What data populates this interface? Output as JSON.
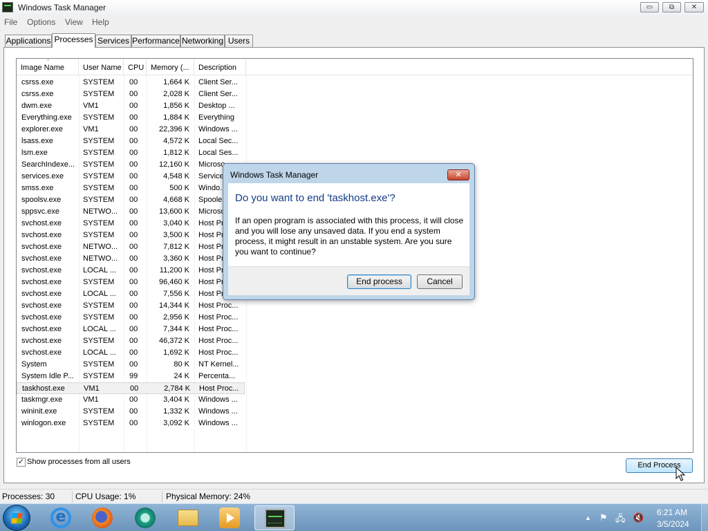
{
  "window": {
    "title": "Windows Task Manager",
    "controls": {
      "minimize": "▭",
      "maximize": "⧉",
      "close": "✕"
    }
  },
  "menu": [
    "File",
    "Options",
    "View",
    "Help"
  ],
  "tabs": [
    "Applications",
    "Processes",
    "Services",
    "Performance",
    "Networking",
    "Users"
  ],
  "active_tab": "Processes",
  "columns": [
    "Image Name",
    "User Name",
    "CPU",
    "Memory (...",
    "Description"
  ],
  "sort_indicator": "^",
  "processes": [
    {
      "name": "csrss.exe",
      "user": "SYSTEM",
      "cpu": "00",
      "memory": "1,664 K",
      "description": "Client Ser..."
    },
    {
      "name": "csrss.exe",
      "user": "SYSTEM",
      "cpu": "00",
      "memory": "2,028 K",
      "description": "Client Ser..."
    },
    {
      "name": "dwm.exe",
      "user": "VM1",
      "cpu": "00",
      "memory": "1,856 K",
      "description": "Desktop ..."
    },
    {
      "name": "Everything.exe",
      "user": "SYSTEM",
      "cpu": "00",
      "memory": "1,884 K",
      "description": "Everything"
    },
    {
      "name": "explorer.exe",
      "user": "VM1",
      "cpu": "00",
      "memory": "22,396 K",
      "description": "Windows ..."
    },
    {
      "name": "lsass.exe",
      "user": "SYSTEM",
      "cpu": "00",
      "memory": "4,572 K",
      "description": "Local Sec..."
    },
    {
      "name": "lsm.exe",
      "user": "SYSTEM",
      "cpu": "00",
      "memory": "1,812 K",
      "description": "Local Ses..."
    },
    {
      "name": "SearchIndexe...",
      "user": "SYSTEM",
      "cpu": "00",
      "memory": "12,160 K",
      "description": "Microso..."
    },
    {
      "name": "services.exe",
      "user": "SYSTEM",
      "cpu": "00",
      "memory": "4,548 K",
      "description": "Service..."
    },
    {
      "name": "smss.exe",
      "user": "SYSTEM",
      "cpu": "00",
      "memory": "500 K",
      "description": "Windo..."
    },
    {
      "name": "spoolsv.exe",
      "user": "SYSTEM",
      "cpu": "00",
      "memory": "4,668 K",
      "description": "Spoole..."
    },
    {
      "name": "sppsvc.exe",
      "user": "NETWO...",
      "cpu": "00",
      "memory": "13,600 K",
      "description": "Microso..."
    },
    {
      "name": "svchost.exe",
      "user": "SYSTEM",
      "cpu": "00",
      "memory": "3,040 K",
      "description": "Host Pr..."
    },
    {
      "name": "svchost.exe",
      "user": "SYSTEM",
      "cpu": "00",
      "memory": "3,500 K",
      "description": "Host Pr..."
    },
    {
      "name": "svchost.exe",
      "user": "NETWO...",
      "cpu": "00",
      "memory": "7,812 K",
      "description": "Host Pr..."
    },
    {
      "name": "svchost.exe",
      "user": "NETWO...",
      "cpu": "00",
      "memory": "3,360 K",
      "description": "Host Pr..."
    },
    {
      "name": "svchost.exe",
      "user": "LOCAL ...",
      "cpu": "00",
      "memory": "11,200 K",
      "description": "Host Pr..."
    },
    {
      "name": "svchost.exe",
      "user": "SYSTEM",
      "cpu": "00",
      "memory": "96,460 K",
      "description": "Host Pr..."
    },
    {
      "name": "svchost.exe",
      "user": "LOCAL ...",
      "cpu": "00",
      "memory": "7,556 K",
      "description": "Host Pr..."
    },
    {
      "name": "svchost.exe",
      "user": "SYSTEM",
      "cpu": "00",
      "memory": "14,344 K",
      "description": "Host Proc..."
    },
    {
      "name": "svchost.exe",
      "user": "SYSTEM",
      "cpu": "00",
      "memory": "2,956 K",
      "description": "Host Proc..."
    },
    {
      "name": "svchost.exe",
      "user": "LOCAL ...",
      "cpu": "00",
      "memory": "7,344 K",
      "description": "Host Proc..."
    },
    {
      "name": "svchost.exe",
      "user": "SYSTEM",
      "cpu": "00",
      "memory": "46,372 K",
      "description": "Host Proc..."
    },
    {
      "name": "svchost.exe",
      "user": "LOCAL ...",
      "cpu": "00",
      "memory": "1,692 K",
      "description": "Host Proc..."
    },
    {
      "name": "System",
      "user": "SYSTEM",
      "cpu": "00",
      "memory": "80 K",
      "description": "NT Kernel..."
    },
    {
      "name": "System Idle P...",
      "user": "SYSTEM",
      "cpu": "99",
      "memory": "24 K",
      "description": "Percenta..."
    },
    {
      "name": "taskhost.exe",
      "user": "VM1",
      "cpu": "00",
      "memory": "2,784 K",
      "description": "Host Proc...",
      "selected": true
    },
    {
      "name": "taskmgr.exe",
      "user": "VM1",
      "cpu": "00",
      "memory": "3,404 K",
      "description": "Windows ..."
    },
    {
      "name": "wininit.exe",
      "user": "SYSTEM",
      "cpu": "00",
      "memory": "1,332 K",
      "description": "Windows ..."
    },
    {
      "name": "winlogon.exe",
      "user": "SYSTEM",
      "cpu": "00",
      "memory": "3,092 K",
      "description": "Windows ..."
    }
  ],
  "show_all_users": {
    "label": "Show processes from all users",
    "checked": true,
    "check_glyph": "✓"
  },
  "end_process_button": "End Process",
  "status": {
    "processes": "Processes: 30",
    "cpu_usage": "CPU Usage: 1%",
    "physical_memory": "Physical Memory: 24%"
  },
  "dialog": {
    "title": "Windows Task Manager",
    "close_glyph": "✕",
    "heading": "Do you want to end 'taskhost.exe'?",
    "message": "If an open program is associated with this process, it will close and you will lose any unsaved data. If you end a system process, it might result in an unstable system. Are you sure you want to continue?",
    "confirm_button": "End process",
    "cancel_button": "Cancel"
  },
  "taskbar": {
    "apps": [
      "internet-explorer",
      "firefox",
      "chat-app",
      "file-explorer",
      "media-player",
      "task-manager"
    ],
    "active_app": "task-manager",
    "ie_glyph": "e",
    "tray": {
      "expand_glyph": "▲",
      "flag_glyph": "⚑",
      "network_glyph": "🖧",
      "volume_glyph": "🔇"
    },
    "clock": {
      "time": "6:21 AM",
      "date": "3/5/2024"
    }
  },
  "colors": {
    "dialog_heading": "#123c88",
    "taskbar": "#7ba2c8",
    "dialog_close": "#c7432c"
  }
}
